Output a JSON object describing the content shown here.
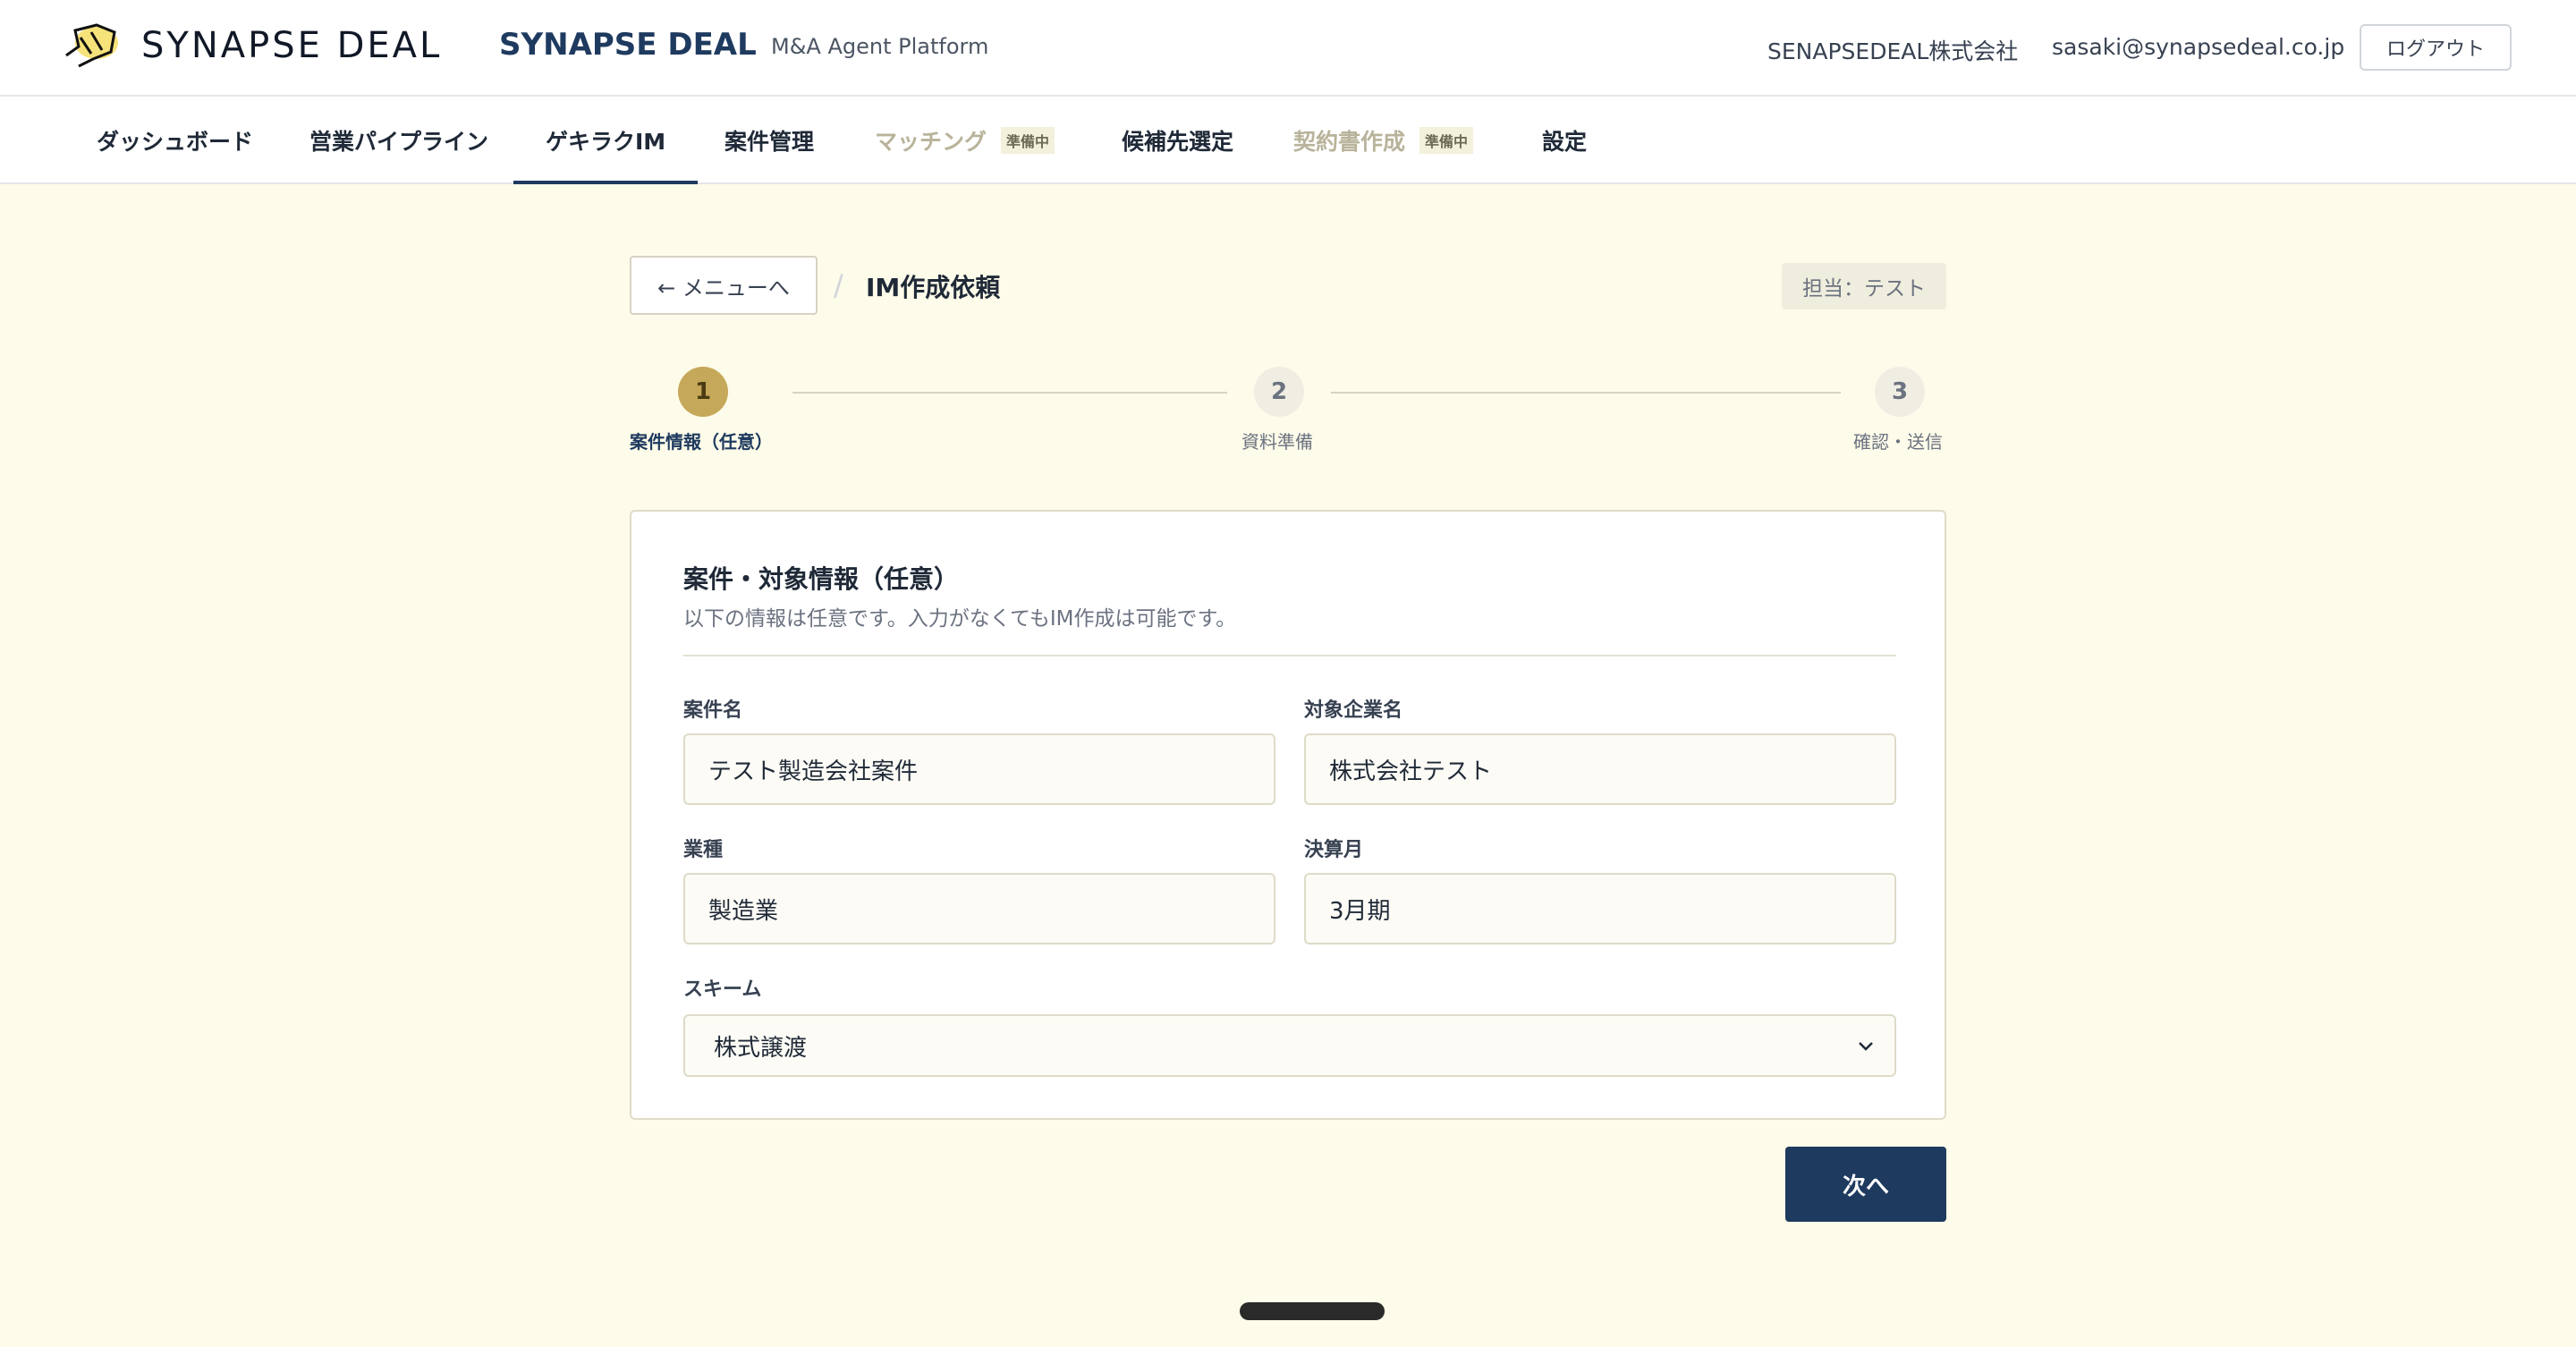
{
  "header": {
    "logo_text": "SYNAPSE DEAL",
    "brand": "SYNAPSE DEAL",
    "tagline": "M&A Agent Platform",
    "company": "SENAPSEDEAL株式会社",
    "email": "sasaki@synapsedeal.co.jp",
    "logout_label": "ログアウト"
  },
  "nav": {
    "items": [
      {
        "label": "ダッシュボード"
      },
      {
        "label": "営業パイプライン"
      },
      {
        "label": "ゲキラクIM",
        "active": true
      },
      {
        "label": "案件管理"
      },
      {
        "label": "マッチング",
        "badge": "準備中",
        "disabled": true
      },
      {
        "label": "候補先選定"
      },
      {
        "label": "契約書作成",
        "badge": "準備中",
        "disabled": true
      },
      {
        "label": "設定"
      }
    ]
  },
  "page": {
    "back_label": "← メニューへ",
    "separator": "/",
    "title": "IM作成依頼",
    "owner": "担当：テスト"
  },
  "stepper": {
    "steps": [
      {
        "number": "1",
        "label": "案件情報（任意）",
        "state": "current"
      },
      {
        "number": "2",
        "label": "資料準備",
        "state": "future"
      },
      {
        "number": "3",
        "label": "確認・送信",
        "state": "future"
      }
    ]
  },
  "form": {
    "title": "案件・対象情報（任意）",
    "subtitle": "以下の情報は任意です。入力がなくてもIM作成は可能です。",
    "fields": {
      "deal_name": {
        "label": "案件名",
        "value": "テスト製造会社案件"
      },
      "target_company": {
        "label": "対象企業名",
        "value": "株式会社テスト"
      },
      "industry": {
        "label": "業種",
        "value": "製造業"
      },
      "fiscal_month": {
        "label": "決算月",
        "value": "3月期"
      },
      "scheme": {
        "label": "スキーム",
        "value": "株式譲渡"
      }
    }
  },
  "actions": {
    "next_label": "次へ"
  },
  "colors": {
    "primary": "#1e3a5f",
    "accent_gold": "#c6a85a",
    "background": "#fdfbe9"
  }
}
